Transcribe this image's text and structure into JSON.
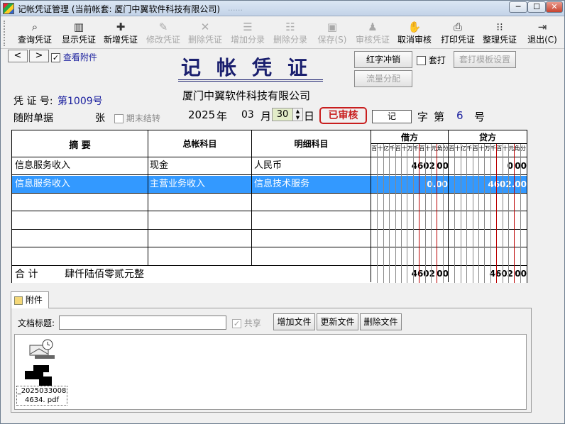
{
  "window": {
    "title": "记帐凭证管理 (当前帐套: 厦门中翼软件科技有限公司)",
    "title_faded": "......",
    "buttons": [
      "─",
      "☐",
      "✕"
    ]
  },
  "toolbar": [
    {
      "label": "查询凭证",
      "icon": "search-icon",
      "glyph": "⌕",
      "enabled": true
    },
    {
      "label": "显示凭证",
      "icon": "display-icon",
      "glyph": "▥",
      "enabled": true
    },
    {
      "label": "新增凭证",
      "icon": "add-icon",
      "glyph": "✚",
      "enabled": true
    },
    {
      "label": "修改凭证",
      "icon": "edit-icon",
      "glyph": "✎",
      "enabled": false
    },
    {
      "label": "删除凭证",
      "icon": "delete-icon",
      "glyph": "✕",
      "enabled": false
    },
    {
      "label": "增加分录",
      "icon": "add-entry-icon",
      "glyph": "☰",
      "enabled": false
    },
    {
      "label": "删除分录",
      "icon": "delete-entry-icon",
      "glyph": "☷",
      "enabled": false
    },
    {
      "label": "保存(S)",
      "icon": "save-icon",
      "glyph": "▣",
      "enabled": false
    },
    {
      "label": "审核凭证",
      "icon": "audit-icon",
      "glyph": "♟",
      "enabled": false
    },
    {
      "label": "取消审核",
      "icon": "hand-icon",
      "glyph": "✋",
      "enabled": true
    },
    {
      "label": "打印凭证",
      "icon": "print-icon",
      "glyph": "⎙",
      "enabled": true
    },
    {
      "label": "整理凭证",
      "icon": "organize-icon",
      "glyph": "⁝⁝",
      "enabled": true
    },
    {
      "label": "退出(C)",
      "icon": "exit-icon",
      "glyph": "⇥",
      "enabled": true
    }
  ],
  "nav": {
    "prev": "<",
    "next": ">",
    "view_attachment": "查看附件",
    "view_attachment_checked": true
  },
  "voucher": {
    "heading": "记帐凭证",
    "company": "厦门中翼软件科技有限公司",
    "number_label": "凭 证 号:",
    "number": "第1009号",
    "attach_label": "随附单据",
    "attach_unit": "张",
    "period_end_label": "期末结转",
    "year": "2025",
    "year_unit": "年",
    "month": "03",
    "month_unit": "月",
    "day": "30",
    "day_unit": "日",
    "status": "已审核",
    "word": "记",
    "word_label": "字",
    "seq_prefix": "第",
    "seq": "6",
    "seq_unit": "号"
  },
  "side_buttons": {
    "reverse": "红字冲销",
    "profit_split": "流量分配",
    "overprint": "套打",
    "template": "套打模板设置"
  },
  "table": {
    "headers": {
      "summary": "摘  要",
      "general": "总帐科目",
      "detail": "明细科目",
      "debit": "借方",
      "credit": "贷方"
    },
    "units": [
      "百",
      "十",
      "亿",
      "千",
      "百",
      "十",
      "万",
      "千",
      "百",
      "十",
      "元",
      "角",
      "分"
    ],
    "rows": [
      {
        "summary": "信息服务收入",
        "general": "现金",
        "detail": "人民币",
        "debit": "4602",
        "debit_cents": "00",
        "credit": "0",
        "credit_cents": "00",
        "selected": false
      },
      {
        "summary": "信息服务收入",
        "general": "主营业务收入",
        "detail": "信息技术服务",
        "debit": "0.00",
        "debit_cents": "",
        "credit": "4602.00",
        "credit_cents": "",
        "selected": true
      }
    ],
    "total_label": "合  计",
    "total_words": "肆仟陆佰零贰元整",
    "total_debit": "4602",
    "total_debit_cents": "00",
    "total_credit": "4602",
    "total_credit_cents": "00"
  },
  "attachment": {
    "tab": "附件",
    "doc_title_label": "文档标题:",
    "doc_title_value": "",
    "share_label": "共享",
    "share_checked": true,
    "add_file": "增加文件",
    "update_file": "更新文件",
    "delete_file": "删除文件",
    "file_name_line1": "_2025033008",
    "file_name_line2": "4634. pdf"
  }
}
